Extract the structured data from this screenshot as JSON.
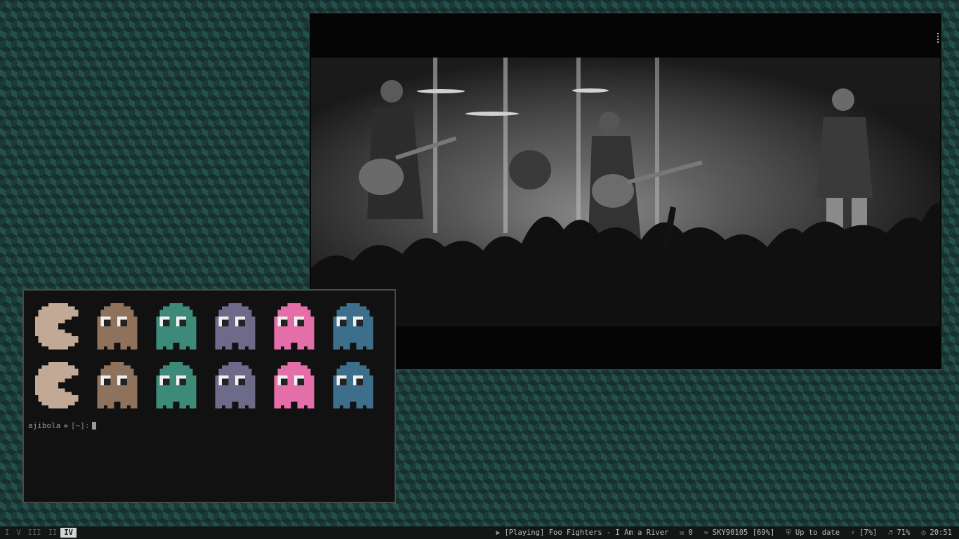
{
  "terminal": {
    "user": "ajibola",
    "prompt_arrow": "»",
    "prompt_rest": "[~]:",
    "sprites": [
      {
        "kind": "pacman",
        "color": "#c2a996"
      },
      {
        "kind": "ghost",
        "color": "#8f725c"
      },
      {
        "kind": "ghost",
        "color": "#3e8a78"
      },
      {
        "kind": "ghost",
        "color": "#6e6a8a"
      },
      {
        "kind": "ghost",
        "color": "#e46ea8"
      },
      {
        "kind": "ghost",
        "color": "#3d6f8c"
      },
      {
        "kind": "pacman",
        "color": "#c2a996"
      },
      {
        "kind": "ghost",
        "color": "#8f725c"
      },
      {
        "kind": "ghost",
        "color": "#3e8a78"
      },
      {
        "kind": "ghost",
        "color": "#6e6a8a"
      },
      {
        "kind": "ghost",
        "color": "#e46ea8"
      },
      {
        "kind": "ghost",
        "color": "#3d6f8c"
      }
    ]
  },
  "statusbar": {
    "workspaces": [
      "I",
      "V",
      "III",
      "II",
      "IV"
    ],
    "active_workspace": "IV",
    "media": {
      "icon": "play-circle-icon",
      "text": "[Playing] Foo Fighters - I Am a River"
    },
    "mail": {
      "icon": "mail-icon",
      "text": "0"
    },
    "wifi": {
      "icon": "wifi-icon",
      "text": "SKY90105 [69%]"
    },
    "updates": {
      "icon": "shield-icon",
      "text": "Up to date"
    },
    "battery": {
      "icon": "bolt-icon",
      "text": "[7%]"
    },
    "volume": {
      "icon": "speaker-icon",
      "text": "71%"
    },
    "clock": {
      "icon": "clock-icon",
      "text": "20:51"
    }
  },
  "colors": {
    "wallpaper": "#1c3a38",
    "terminal_bg": "#111112",
    "statusbar_bg": "#141616",
    "ghost_eye_white": "#eeeeee",
    "ghost_pupil": "#222222"
  }
}
